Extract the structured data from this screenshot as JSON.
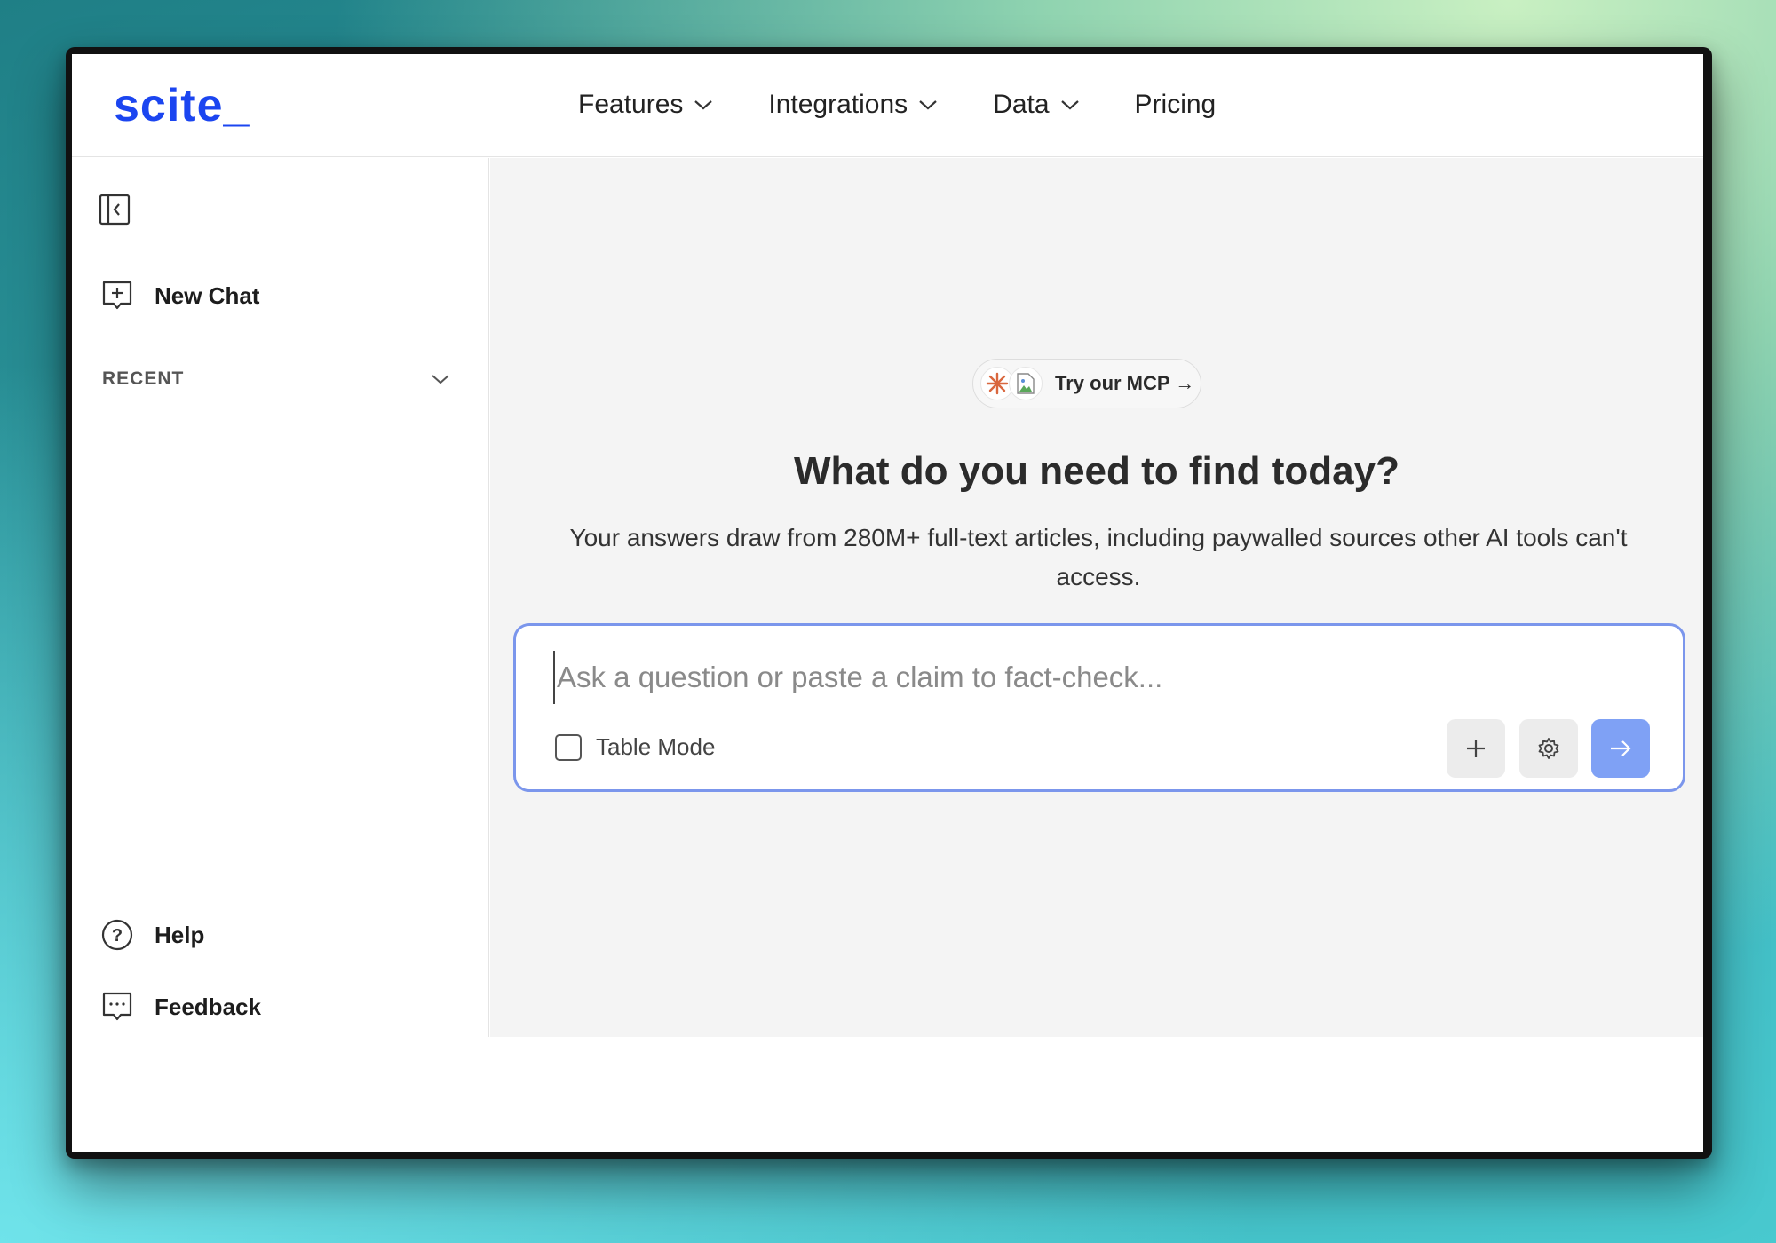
{
  "header": {
    "logo": "scite_",
    "nav": [
      {
        "label": "Features",
        "has_dropdown": true
      },
      {
        "label": "Integrations",
        "has_dropdown": true
      },
      {
        "label": "Data",
        "has_dropdown": true
      },
      {
        "label": "Pricing",
        "has_dropdown": false
      }
    ]
  },
  "sidebar": {
    "new_chat": "New Chat",
    "recent": "RECENT",
    "help": "Help",
    "feedback": "Feedback"
  },
  "main": {
    "mcp_pill": "Try our MCP →",
    "headline": "What do you need to find today?",
    "subline": "Your answers draw from 280M+ full-text articles, including paywalled sources other AI tools can't access.",
    "input_placeholder": "Ask a question or paste a claim to fact-check...",
    "table_mode": "Table Mode"
  },
  "colors": {
    "brand": "#1b45f0",
    "chatbox_border": "#7b96ec",
    "send_button": "#7fa1f5"
  }
}
